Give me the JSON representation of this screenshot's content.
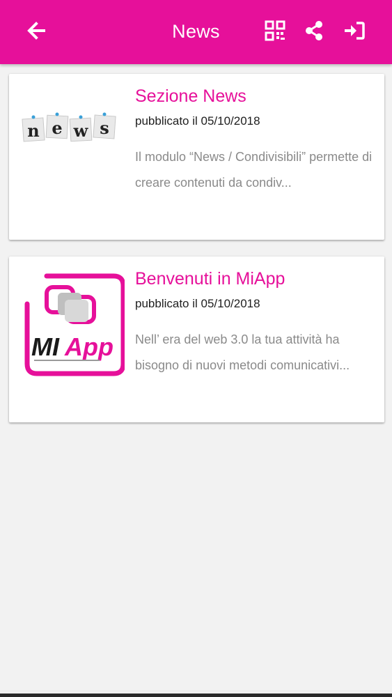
{
  "header": {
    "title": "News",
    "background": "#e6109a",
    "icons": [
      "arrow-left-icon",
      "qr-code-icon",
      "share-icon",
      "sign-in-icon"
    ]
  },
  "news": [
    {
      "title": "Sezione News",
      "date": "pubblicato il 05/10/2018",
      "excerpt": "Il modulo “News / Condivisibili” permette di creare contenuti da condiv...",
      "image_text": "news"
    },
    {
      "title": "Benvenuti in MiApp",
      "date": "pubblicato il 05/10/2018",
      "excerpt": "Nell’ era del web 3.0 la tua attività ha bisogno di nuovi metodi comunicativi...",
      "image_text": "MiApp"
    }
  ],
  "colors": {
    "accent": "#e6109a",
    "background": "#f2f2f2",
    "card": "#ffffff"
  }
}
